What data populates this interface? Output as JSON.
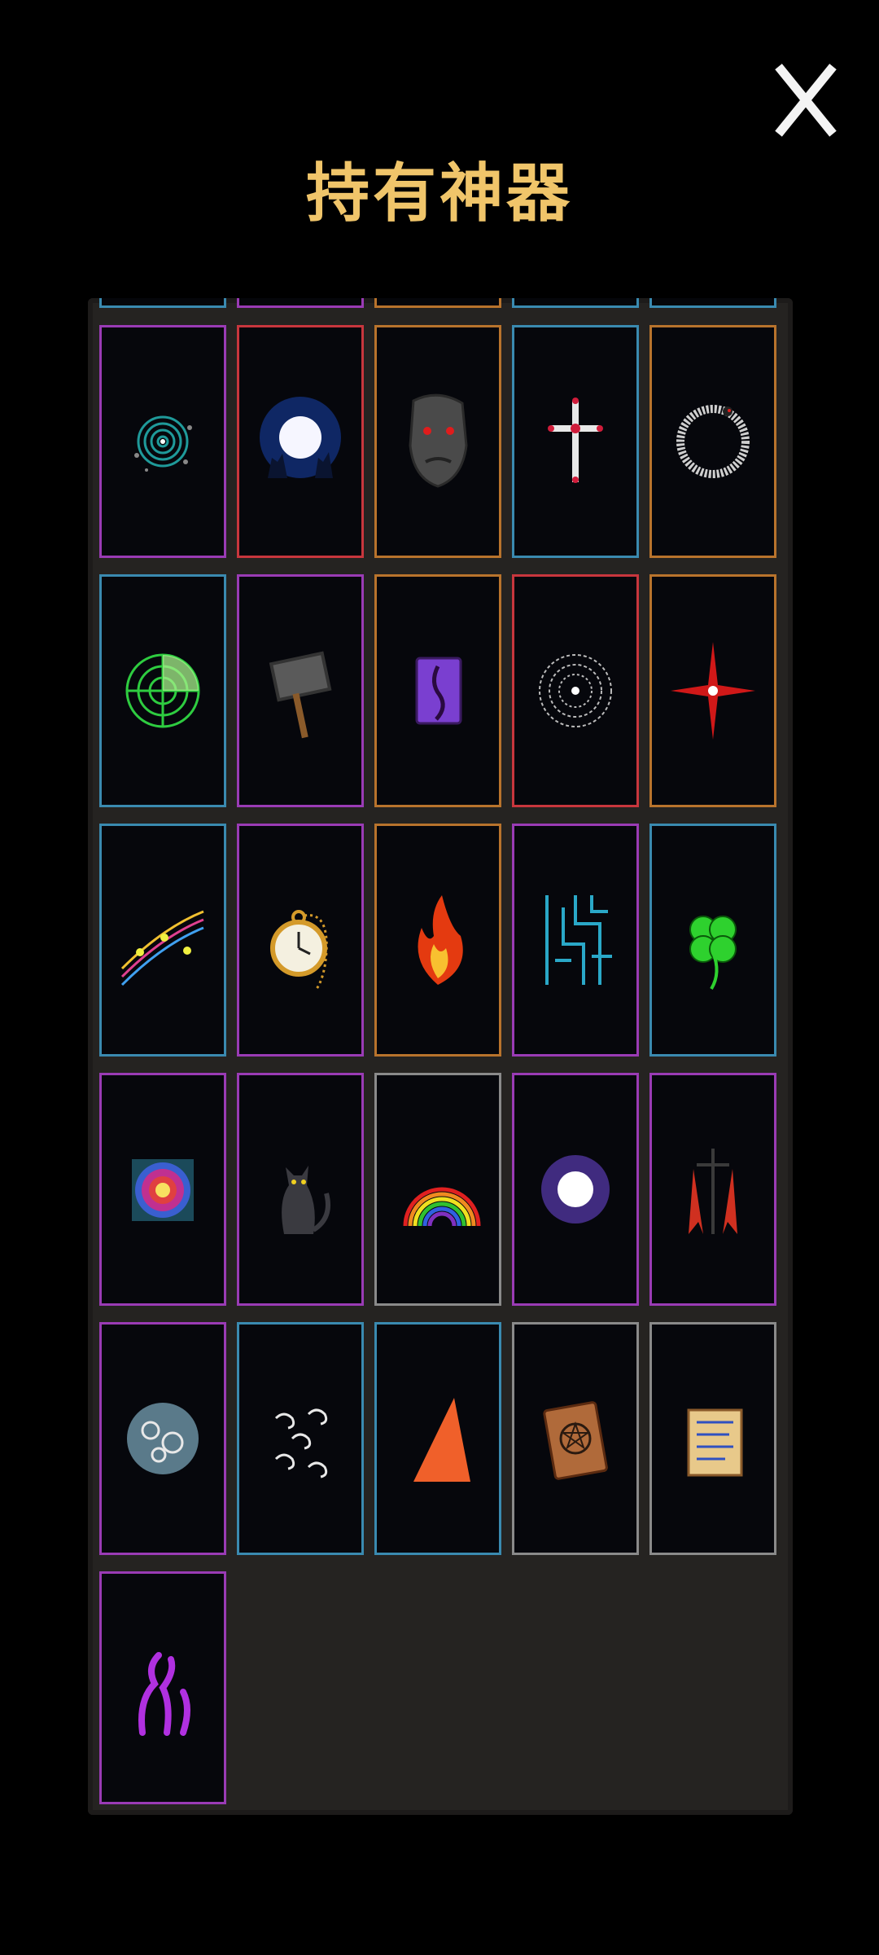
{
  "screen": {
    "title": "持有神器",
    "close_label": "X"
  },
  "colors": {
    "title": "#f0c56a",
    "panel": "#252321",
    "card_bg": "#06070c"
  },
  "partial_top_row_borders": [
    "#3a8ab0",
    "#9a3bb5",
    "#b8732c",
    "#3a8ab0",
    "#3a8ab0"
  ],
  "artifacts": [
    {
      "icon": "spiral-vortex-icon",
      "border": "#9a3bb5"
    },
    {
      "icon": "blue-moon-wolves-icon",
      "border": "#c8363d"
    },
    {
      "icon": "stone-face-icon",
      "border": "#b8732c"
    },
    {
      "icon": "holy-cross-icon",
      "border": "#3a8ab0"
    },
    {
      "icon": "ouroboros-icon",
      "border": "#b8732c"
    },
    {
      "icon": "radar-icon",
      "border": "#3a8ab0"
    },
    {
      "icon": "war-hammer-icon",
      "border": "#9a3bb5"
    },
    {
      "icon": "tentacle-book-icon",
      "border": "#b8732c"
    },
    {
      "icon": "dark-orb-icon",
      "border": "#c8363d"
    },
    {
      "icon": "red-star-icon",
      "border": "#b8732c"
    },
    {
      "icon": "music-notes-icon",
      "border": "#3a8ab0"
    },
    {
      "icon": "pocket-watch-icon",
      "border": "#9a3bb5"
    },
    {
      "icon": "flame-icon",
      "border": "#b8732c"
    },
    {
      "icon": "circuit-icon",
      "border": "#9a3bb5"
    },
    {
      "icon": "four-leaf-clover-icon",
      "border": "#3a8ab0"
    },
    {
      "icon": "psychedelic-square-icon",
      "border": "#9a3bb5"
    },
    {
      "icon": "black-cat-icon",
      "border": "#9a3bb5"
    },
    {
      "icon": "rainbow-icon",
      "border": "#8a8a8a"
    },
    {
      "icon": "purple-void-orb-icon",
      "border": "#9a3bb5"
    },
    {
      "icon": "red-banner-icon",
      "border": "#9a3bb5"
    },
    {
      "icon": "cloud-orb-icon",
      "border": "#9a3bb5"
    },
    {
      "icon": "wind-swirls-icon",
      "border": "#3a8ab0"
    },
    {
      "icon": "red-spike-icon",
      "border": "#3a8ab0"
    },
    {
      "icon": "pentagram-tome-icon",
      "border": "#8a8a8a"
    },
    {
      "icon": "ancient-scroll-icon",
      "border": "#8a8a8a"
    },
    {
      "icon": "purple-tentacles-icon",
      "border": "#9a3bb5"
    }
  ]
}
